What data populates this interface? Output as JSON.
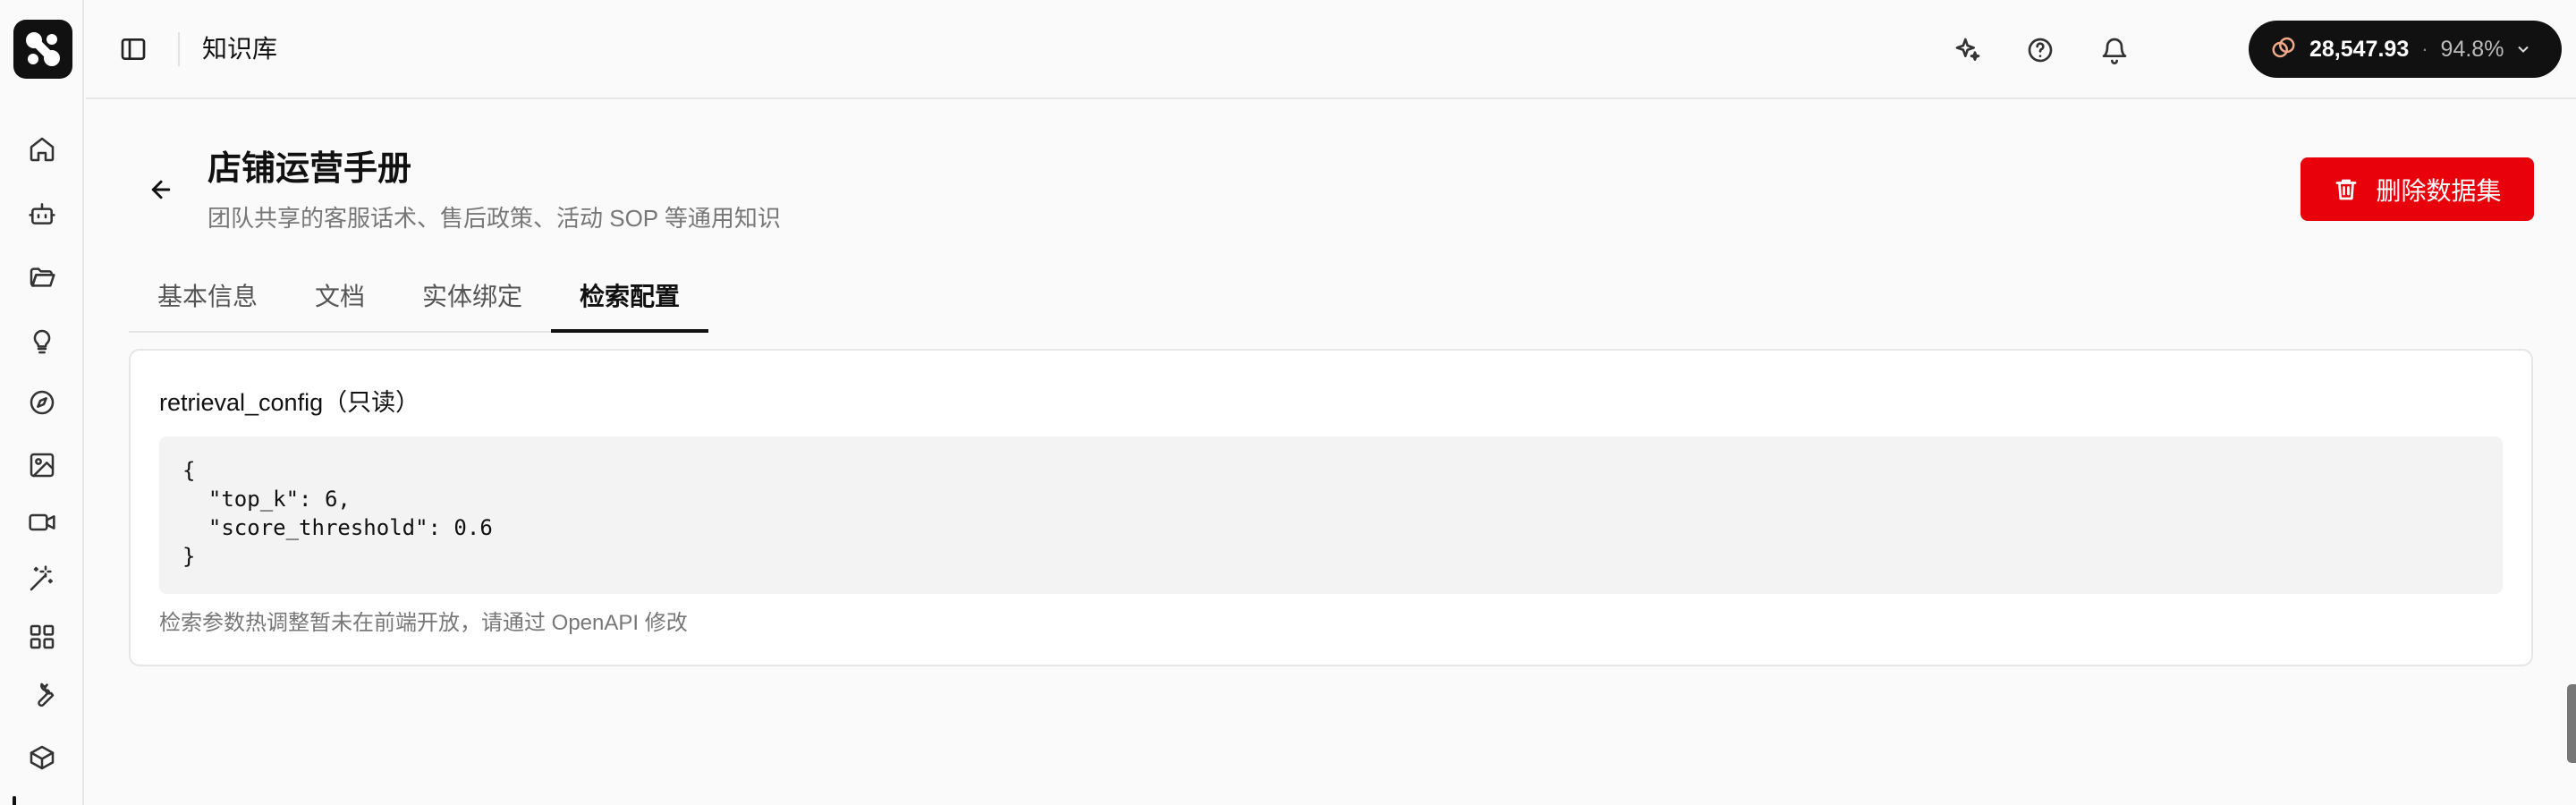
{
  "app": {
    "section_title": "知识库"
  },
  "sidebar": {
    "items": [
      {
        "name": "home",
        "icon": "home-icon"
      },
      {
        "name": "bot",
        "icon": "bot-icon"
      },
      {
        "name": "folder",
        "icon": "folder-open-icon"
      },
      {
        "name": "ideas",
        "icon": "lightbulb-icon"
      },
      {
        "name": "explore",
        "icon": "compass-icon"
      },
      {
        "name": "image",
        "icon": "image-icon"
      },
      {
        "name": "video",
        "icon": "video-icon"
      },
      {
        "name": "magic",
        "icon": "magic-wand-icon"
      },
      {
        "name": "apps",
        "icon": "grid-icon"
      },
      {
        "name": "tools",
        "icon": "wrench-icon"
      },
      {
        "name": "package",
        "icon": "package-icon"
      }
    ]
  },
  "header": {
    "credits": {
      "value": "28,547.93",
      "separator": "·",
      "percent": "94.8%"
    }
  },
  "page": {
    "title": "店铺运营手册",
    "subtitle": "团队共享的客服话术、售后政策、活动 SOP 等通用知识",
    "delete_label": "删除数据集"
  },
  "tabs": [
    {
      "label": "基本信息",
      "active": false
    },
    {
      "label": "文档",
      "active": false
    },
    {
      "label": "实体绑定",
      "active": false
    },
    {
      "label": "检索配置",
      "active": true
    }
  ],
  "card": {
    "title": "retrieval_config（只读）",
    "code": "{\n  \"top_k\": 6,\n  \"score_threshold\": 0.6\n}",
    "hint": "检索参数热调整暂未在前端开放，请通过 OpenAPI 修改"
  },
  "colors": {
    "accent": "#111111",
    "danger": "#e8000b",
    "background": "#fafafa"
  }
}
